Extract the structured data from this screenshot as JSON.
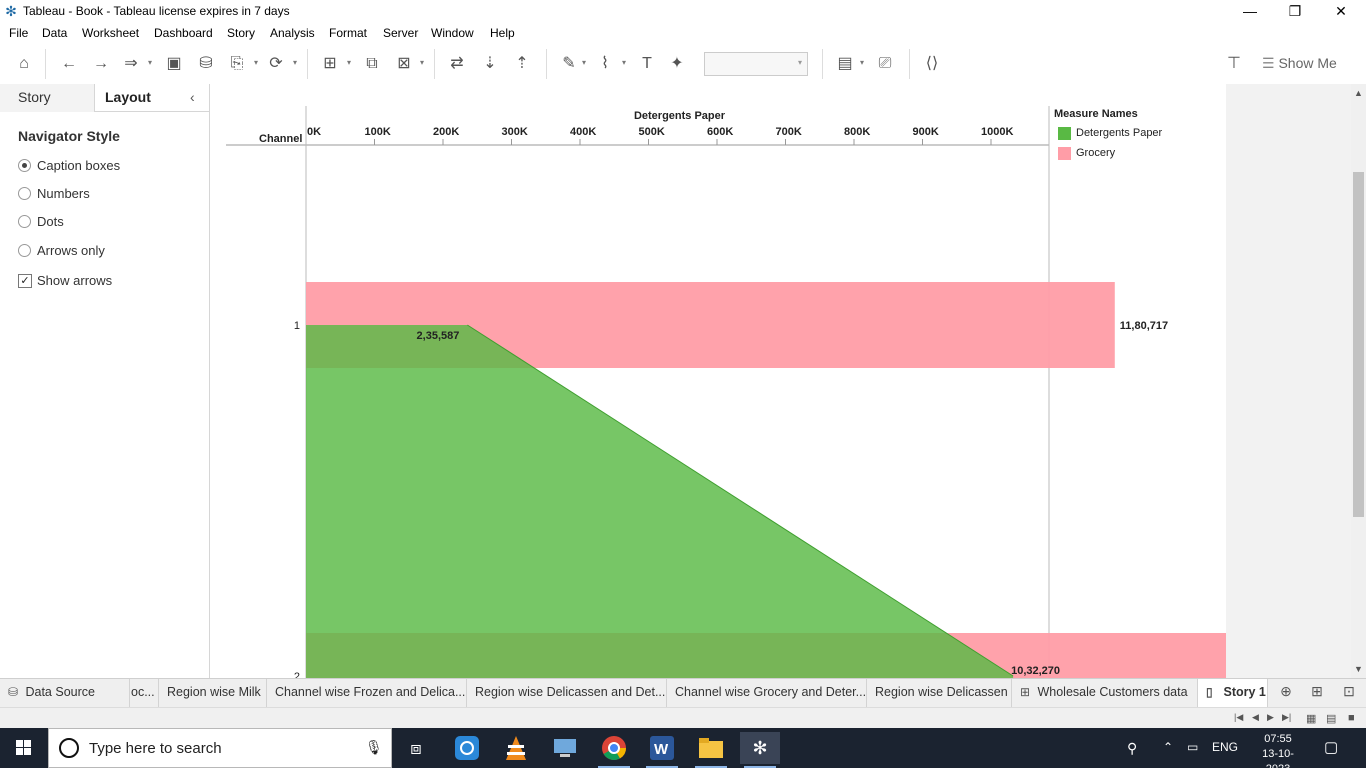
{
  "window": {
    "title": "Tableau - Book - Tableau license expires in 7 days",
    "icon": "tableau-logo-icon",
    "controls": [
      "minimize-icon",
      "restore-icon",
      "close-icon"
    ]
  },
  "menu": [
    "File",
    "Data",
    "Worksheet",
    "Dashboard",
    "Story",
    "Analysis",
    "Format",
    "Server",
    "Window",
    "Help"
  ],
  "toolbar": {
    "show_me": "Show Me",
    "dropdown_value": ""
  },
  "left_panel": {
    "tabs": [
      "Story",
      "Layout"
    ],
    "active_tab": "Layout",
    "section_title": "Navigator Style",
    "options": [
      {
        "label": "Caption boxes",
        "selected": true
      },
      {
        "label": "Numbers",
        "selected": false
      },
      {
        "label": "Dots",
        "selected": false
      },
      {
        "label": "Arrows only",
        "selected": false
      }
    ],
    "show_arrows": {
      "label": "Show arrows",
      "checked": true
    }
  },
  "chart_data": {
    "type": "area",
    "title": "",
    "xlabel": "Detergents Paper",
    "ylabel": "Channel",
    "x_ticks": [
      "0K",
      "100K",
      "200K",
      "300K",
      "400K",
      "500K",
      "600K",
      "700K",
      "800K",
      "900K",
      "1000K"
    ],
    "xlim": [
      0,
      1085000
    ],
    "categories": [
      "1",
      "2"
    ],
    "series": [
      {
        "name": "Detergents Paper",
        "color": "#59b944",
        "values": [
          235587,
          1032270
        ],
        "labels": [
          "2,35,587",
          "10,32,270"
        ]
      },
      {
        "name": "Grocery",
        "color": "#ff9da7",
        "values": [
          1180717,
          2317845
        ],
        "labels": [
          "11,80,717",
          ""
        ]
      }
    ],
    "legend": {
      "title": "Measure Names",
      "position": "right"
    },
    "grid": false
  },
  "sheet_tabs": [
    {
      "label": "Data Source",
      "icon": "database-icon",
      "active": false
    },
    {
      "label": "oc...",
      "icon": "",
      "active": false
    },
    {
      "label": "Region wise Milk",
      "icon": "",
      "active": false
    },
    {
      "label": "Channel wise Frozen and Delica...",
      "icon": "",
      "active": false
    },
    {
      "label": "Region wise Delicassen and Det...",
      "icon": "",
      "active": false
    },
    {
      "label": "Channel wise Grocery and Deter...",
      "icon": "",
      "active": false
    },
    {
      "label": "Region wise Delicassen",
      "icon": "",
      "active": false
    },
    {
      "label": "Wholesale Customers data",
      "icon": "dashboard-icon",
      "active": false
    },
    {
      "label": "Story 1",
      "icon": "story-icon",
      "active": true
    }
  ],
  "taskbar": {
    "search_placeholder": "Type here to search",
    "language": "ENG",
    "time": "07:55",
    "date": "13-10-2023"
  }
}
